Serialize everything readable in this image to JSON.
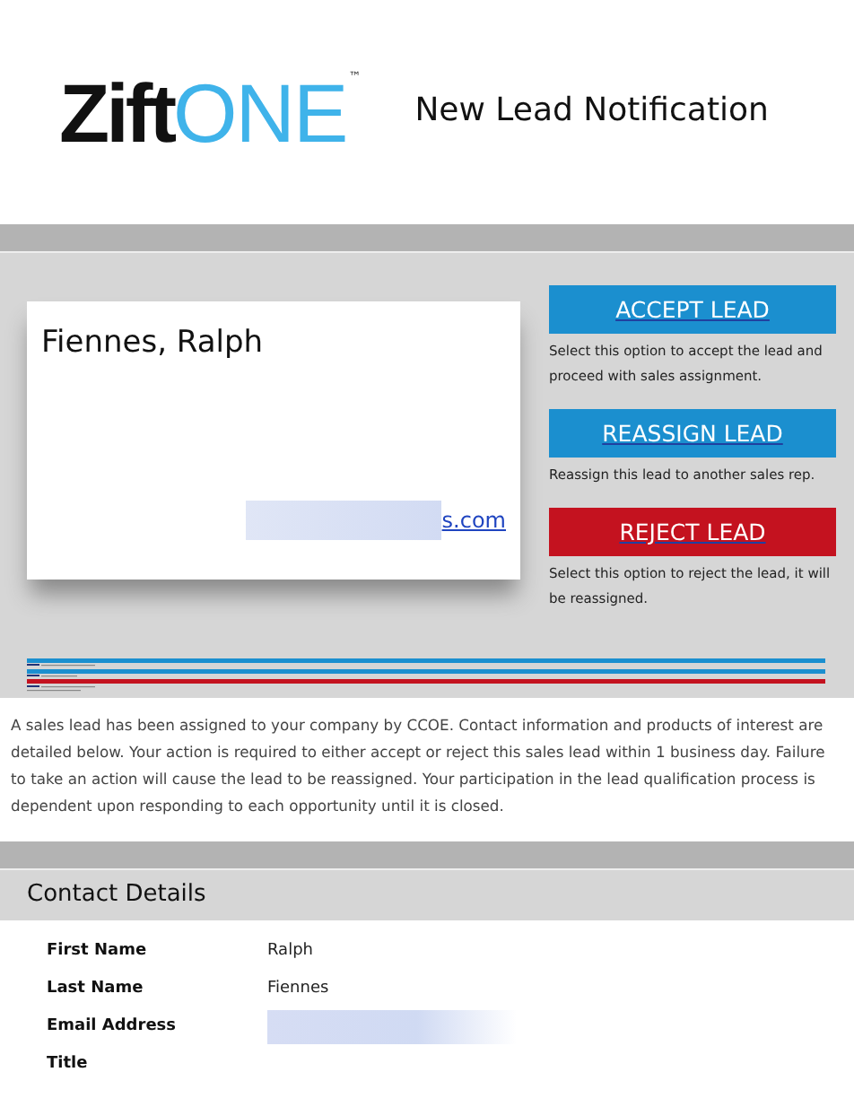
{
  "header": {
    "logo_word": "Zift",
    "logo_accent": "ONE",
    "logo_mark": "™",
    "title": "New Lead Notification"
  },
  "lead_card": {
    "name": "Fiennes, Ralph",
    "email_tail": "s.com",
    "email_redacted": true
  },
  "actions": [
    {
      "label": "ACCEPT LEAD",
      "kind": "accept",
      "description": "Select this option to accept the lead and proceed with sales assignment."
    },
    {
      "label": "REASSIGN LEAD",
      "kind": "reassign",
      "description": "Reassign this lead to another sales rep."
    },
    {
      "label": "REJECT LEAD",
      "kind": "reject",
      "description": "Select this option to reject the lead, it will be reassigned."
    }
  ],
  "intro": "A sales lead has been assigned to your company by CCOE. Contact information and products of interest are detailed below. Your action is required to either accept or reject this sales lead within 1 business day. Failure to take an action will cause the lead to be reassigned. Your participation in the lead qualification process is dependent upon responding to each opportunity until it is closed.",
  "contact_details": {
    "heading": "Contact Details",
    "fields": [
      {
        "label": "First Name",
        "value": "Ralph",
        "redacted": false
      },
      {
        "label": "Last Name",
        "value": "Fiennes",
        "redacted": false
      },
      {
        "label": "Email Address",
        "redacted": true
      },
      {
        "label": "Title",
        "redacted": false
      }
    ]
  }
}
